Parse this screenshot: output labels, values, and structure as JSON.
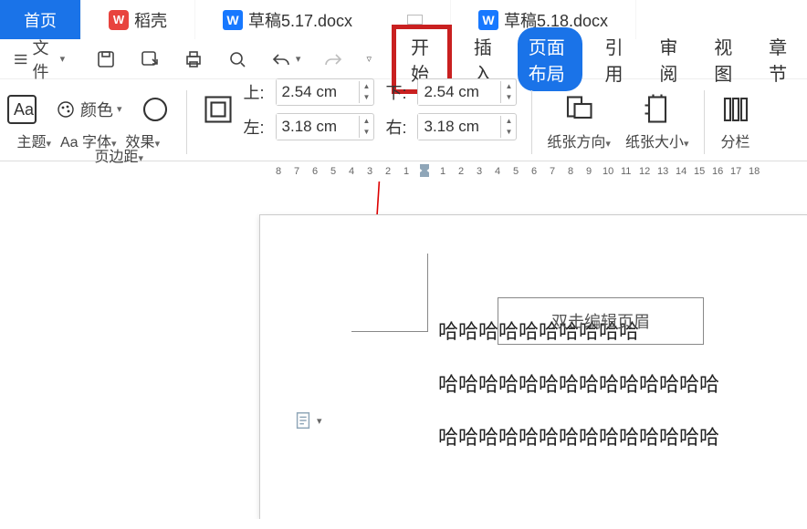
{
  "tabs": {
    "home": "首页",
    "t1": "稻壳",
    "t2": "草稿5.17.docx",
    "t3": "草稿5.18.docx"
  },
  "toolbar": {
    "file": "文件",
    "menu": {
      "start": "开始",
      "insert": "插入",
      "pageLayout": "页面布局",
      "reference": "引用",
      "review": "审阅",
      "view": "视图",
      "chapter": "章节"
    }
  },
  "ribbon": {
    "theme": "主题",
    "color": "颜色",
    "font": "字体",
    "effect": "效果",
    "margin": "页边距",
    "top": "上:",
    "bottom": "下:",
    "left": "左:",
    "right": "右:",
    "topVal": "2.54 cm",
    "bottomVal": "2.54 cm",
    "leftVal": "3.18 cm",
    "rightVal": "3.18 cm",
    "orientation": "纸张方向",
    "size": "纸张大小",
    "columns": "分栏"
  },
  "ruler": [
    "8",
    "7",
    "6",
    "5",
    "4",
    "3",
    "2",
    "1",
    "",
    "1",
    "2",
    "3",
    "4",
    "5",
    "6",
    "7",
    "8",
    "9",
    "10",
    "11",
    "12",
    "13",
    "14",
    "15",
    "16",
    "17",
    "18"
  ],
  "doc": {
    "headerHint": "双击编辑页眉",
    "p1": "哈哈哈哈哈哈哈哈哈哈",
    "p2": "哈哈哈哈哈哈哈哈哈哈哈哈哈哈",
    "p3": "哈哈哈哈哈哈哈哈哈哈哈哈哈哈"
  }
}
